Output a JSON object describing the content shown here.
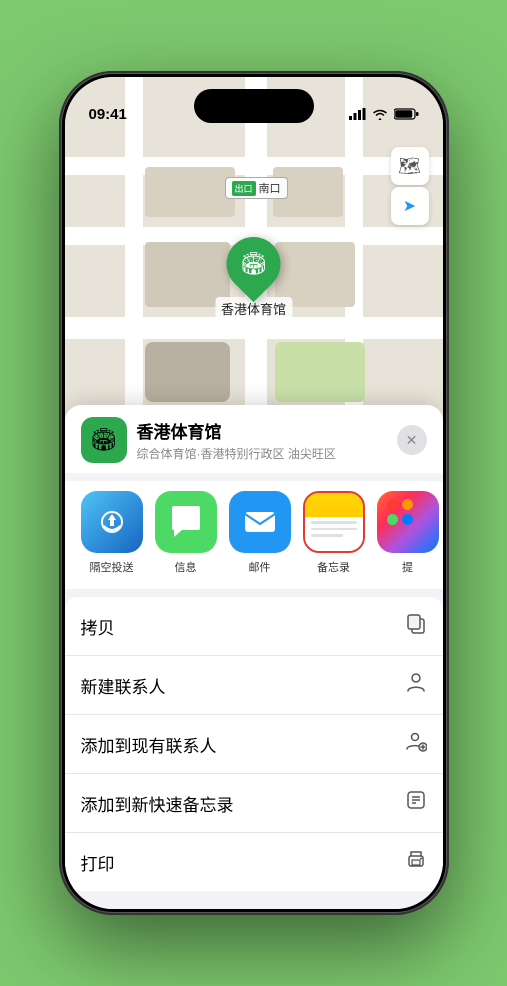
{
  "status_bar": {
    "time": "09:41",
    "signal": "●●●●",
    "wifi": "WiFi",
    "battery": "🔋"
  },
  "map": {
    "label_text": "南口",
    "label_prefix": "出口"
  },
  "location": {
    "name": "香港体育馆",
    "subtitle": "综合体育馆·香港特别行政区 油尖旺区",
    "marker_label": "香港体育馆"
  },
  "share_items": [
    {
      "id": "airdrop",
      "label": "隔空投送"
    },
    {
      "id": "messages",
      "label": "信息"
    },
    {
      "id": "mail",
      "label": "邮件"
    },
    {
      "id": "notes",
      "label": "备忘录"
    },
    {
      "id": "more",
      "label": "提"
    }
  ],
  "action_items": [
    {
      "label": "拷贝",
      "icon": "copy"
    },
    {
      "label": "新建联系人",
      "icon": "person"
    },
    {
      "label": "添加到现有联系人",
      "icon": "person-add"
    },
    {
      "label": "添加到新快速备忘录",
      "icon": "note"
    },
    {
      "label": "打印",
      "icon": "print"
    }
  ],
  "buttons": {
    "close": "✕",
    "map_layer": "🗺",
    "location_arrow": "↗"
  }
}
